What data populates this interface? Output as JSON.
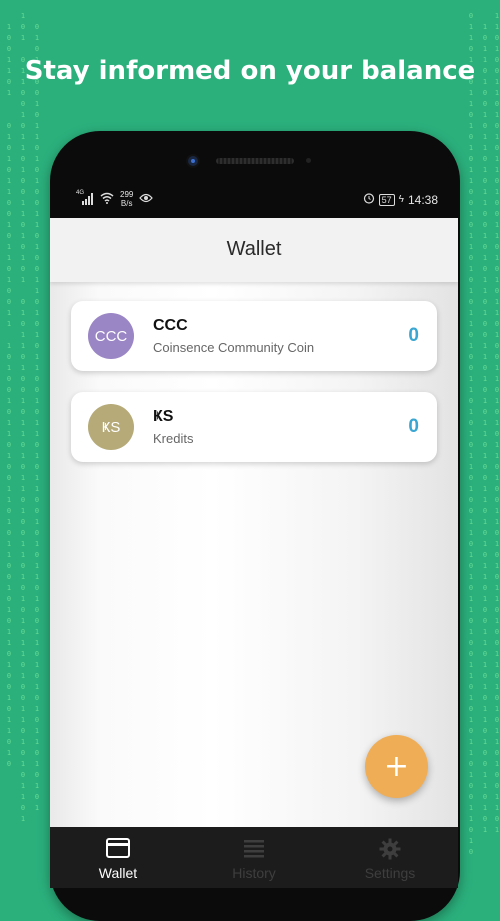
{
  "promo": {
    "headline": "Stay informed on your balance"
  },
  "status_bar": {
    "network_type": "4G",
    "net_speed_value": "299",
    "net_speed_unit": "B/s",
    "battery_level": "57",
    "time": "14:38",
    "icons": [
      "signal-icon",
      "wifi-icon",
      "eye-icon",
      "alarm-icon",
      "battery-icon",
      "charging-icon"
    ]
  },
  "app_bar": {
    "title": "Wallet"
  },
  "wallets": [
    {
      "avatar_text": "CCC",
      "avatar_color": "#9a85c5",
      "code": "CCC",
      "name": "Coinsence Community Coin",
      "balance": "0"
    },
    {
      "avatar_text": "ҜS",
      "avatar_color": "#b5aa78",
      "code": "ҜS",
      "name": "Kredits",
      "balance": "0"
    }
  ],
  "fab": {
    "icon": "plus-icon",
    "color": "#efad56"
  },
  "bottom_nav": {
    "items": [
      {
        "label": "Wallet",
        "icon": "wallet-icon",
        "active": true
      },
      {
        "label": "History",
        "icon": "history-icon",
        "active": false
      },
      {
        "label": "Settings",
        "icon": "gear-icon",
        "active": false
      }
    ]
  },
  "colors": {
    "background": "#2bb07c",
    "balance": "#3aa6d1",
    "nav_bar": "#1c1c1c"
  }
}
